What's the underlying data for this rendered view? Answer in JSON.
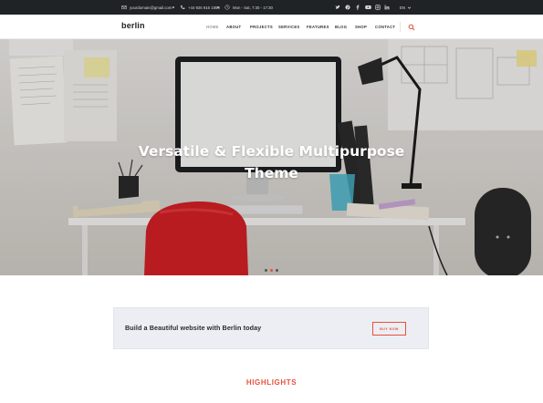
{
  "topbar": {
    "email": "yourdomain@gmail.com",
    "phone": "+44 926 916 1859",
    "hours": "Mon - Sat, 7:30 - 17:30",
    "language": "EN",
    "social": [
      "twitter-icon",
      "pinterest-icon",
      "facebook-icon",
      "youtube-icon",
      "instagram-icon",
      "linkedin-icon"
    ]
  },
  "header": {
    "logo": "berlin",
    "nav": [
      "HOME",
      "ABOUT",
      "PROJECTS",
      "SERVICES",
      "FEATURES",
      "BLOG",
      "SHOP",
      "CONTACT"
    ],
    "active_nav": "HOME"
  },
  "hero": {
    "title_line1": "Versatile & Flexible Multipurpose",
    "title_line2": "Theme",
    "slides": 3,
    "active_slide": 2
  },
  "cta": {
    "text": "Build a Beautiful website with Berlin today",
    "button": "BUY NOW"
  },
  "highlights": {
    "title": "HIGHLIGHTS"
  },
  "colors": {
    "accent": "#e8513a",
    "topbar_bg": "#1f2326",
    "cta_bg": "#eceef4"
  }
}
